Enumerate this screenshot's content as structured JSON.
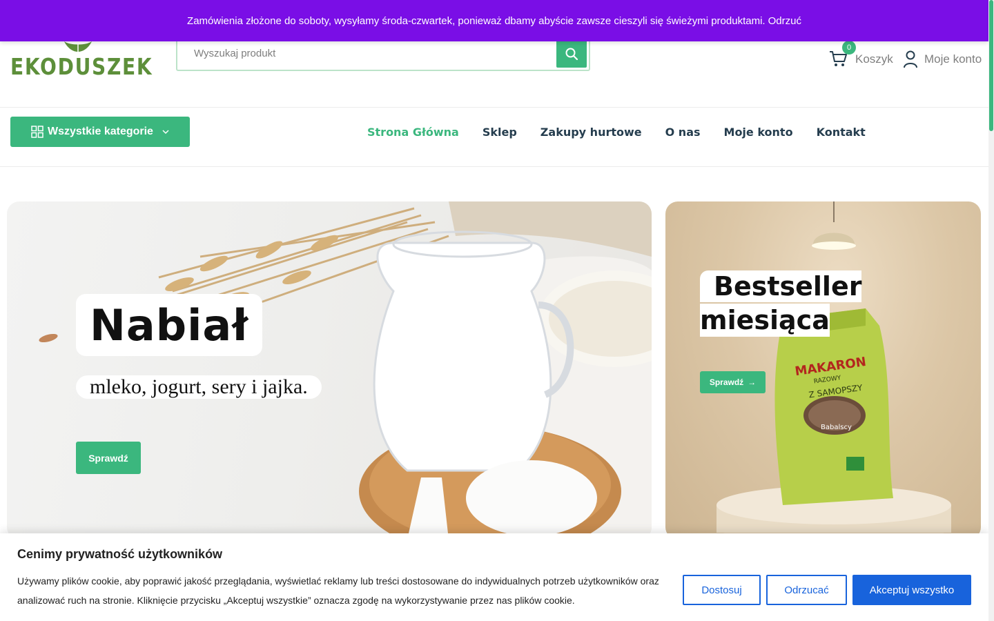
{
  "promo": {
    "text": "Zamówienia złożone do soboty, wysyłamy środa-czwartek, ponieważ dbamy abyście zawsze cieszyli się świeżymi produktami.",
    "dismiss": "Odrzuć"
  },
  "header": {
    "logo_text": "EKODUSZEK",
    "search_placeholder": "Wyszukaj produkt",
    "cart_label": "Koszyk",
    "cart_count": "0",
    "account_label": "Moje konto"
  },
  "nav": {
    "categories_button": "Wszystkie kategorie",
    "items": [
      {
        "label": "Strona Główna",
        "active": true
      },
      {
        "label": "Sklep"
      },
      {
        "label": "Zakupy hurtowe"
      },
      {
        "label": "O nas"
      },
      {
        "label": "Moje konto"
      },
      {
        "label": "Kontakt"
      }
    ]
  },
  "hero_main": {
    "title": "Nabiał",
    "subtitle": "mleko, jogurt, sery i jajka.",
    "button": "Sprawdź"
  },
  "hero_side": {
    "title_line1": "Bestseller",
    "title_line2": "miesiąca",
    "button": "Sprawdź",
    "package_label": "MAKARON",
    "package_sub1": "RAZOWY",
    "package_sub2": "Z SAMOPSZY",
    "package_brand": "Babalscy"
  },
  "cookie": {
    "title": "Cenimy prywatność użytkowników",
    "text": "Używamy plików cookie, aby poprawić jakość przeglądania, wyświetlać reklamy lub treści dostosowane do indywidualnych potrzeb użytkowników oraz analizować ruch na stronie. Kliknięcie przycisku „Akceptuj wszystkie” oznacza zgodę na wykorzystywanie przez nas plików cookie.",
    "customize": "Dostosuj",
    "reject": "Odrzucać",
    "accept": "Akceptuj wszystko"
  },
  "colors": {
    "brand_green": "#3bb77e",
    "promo_purple": "#7a0ee6",
    "cookie_blue": "#1863dc",
    "heading_dark": "#253d4e"
  },
  "icons": [
    "search-icon",
    "cart-icon",
    "user-icon",
    "grid-icon",
    "chevron-down-icon",
    "arrow-right-icon",
    "leaf-icon"
  ]
}
